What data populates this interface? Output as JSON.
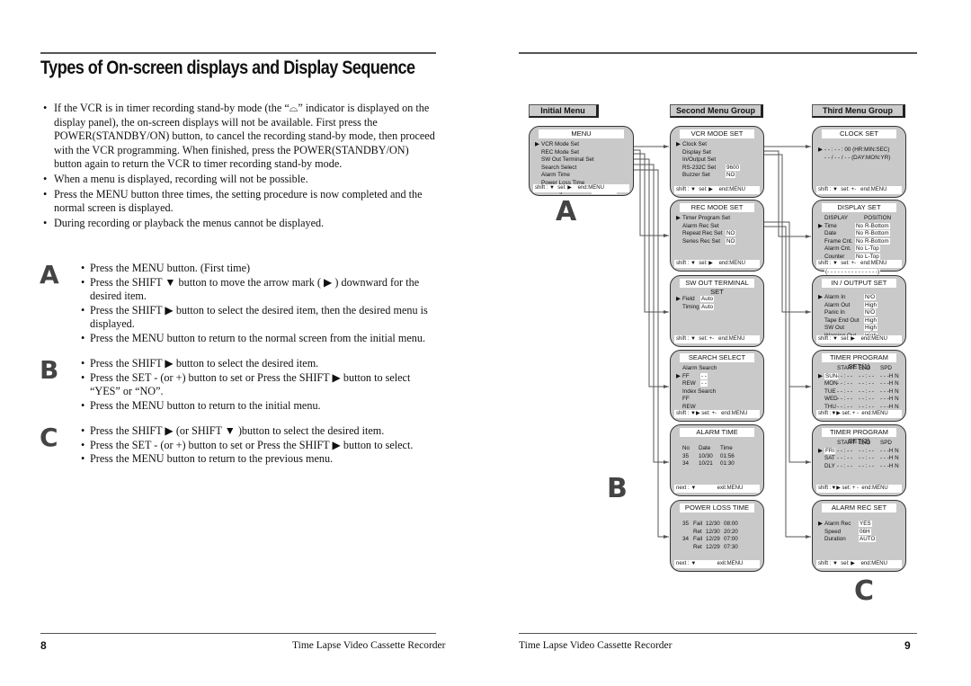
{
  "left": {
    "title": "Types of On-screen displays and Display Sequence",
    "bullets": [
      "If the VCR is in timer recording stand-by mode (the “⌓” indicator is displayed on the display panel), the on-screen displays will not be available. First press the POWER(STANDBY/ON) button, to cancel the recording stand-by mode, then proceed with the VCR programming. When finished, press the POWER(STANDBY/ON) button again to return the VCR to timer recording stand-by mode.",
      "When a menu is displayed, recording will not be possible.",
      "Press the MENU button three times, the setting procedure is now completed and the normal screen is displayed.",
      "During recording or playback the menus cannot be displayed."
    ],
    "steps": [
      {
        "letter": "A",
        "items": [
          "Press the MENU button. (First time)",
          "Press the SHIFT ▼ button to move the arrow mark ( ▶ ) downward for the desired item.",
          "Press the SHIFT ▶ button to select the desired item, then the desired menu is displayed.",
          "Press the MENU button to return to the normal screen from the initial menu."
        ]
      },
      {
        "letter": "B",
        "items": [
          "Press the SHIFT ▶ button to select the desired item.",
          "Press the SET - (or +) button to set or Press the SHIFT ▶ button to select “YES” or “NO”.",
          "Press the MENU button to return to the initial menu."
        ]
      },
      {
        "letter": "C",
        "items": [
          "Press the SHIFT ▶ (or SHIFT ▼ )button to select the desired item.",
          "Press the SET - (or +) button to set or Press the SHIFT ▶ button to select.",
          "Press the MENU button to return to the previous menu."
        ]
      }
    ],
    "page_number": "8",
    "footer": "Time Lapse Video Cassette Recorder"
  },
  "right": {
    "groups": [
      "Initial Menu",
      "Second Menu Group",
      "Third  Menu Group"
    ],
    "letters": [
      "A",
      "B",
      "C"
    ],
    "page_number": "9",
    "footer": "Time Lapse Video Cassette Recorder",
    "selector": "▶",
    "menus": [
      {
        "id": "menu",
        "title": "MENU",
        "footer": "shift : ▼  sel: ▶    end:MENU",
        "lines": [
          {
            "sel": true,
            "cells": [
              "VCR Mode Set"
            ]
          },
          {
            "cells": [
              "REC Mode Set"
            ]
          },
          {
            "cells": [
              "SW Out Terminal Set"
            ]
          },
          {
            "cells": [
              "Search Select"
            ]
          },
          {
            "cells": [
              "Alarm Time"
            ]
          },
          {
            "cells": [
              "Power Loss Time"
            ]
          },
          {
            "cells": [
              "Running Time",
              "000000H"
            ],
            "boxed": [
              1
            ]
          }
        ]
      },
      {
        "id": "vcr",
        "title": "VCR MODE SET",
        "footer": "shift : ▼  sel: ▶    end:MENU",
        "lines": [
          {
            "sel": true,
            "cells": [
              "Clock Set"
            ]
          },
          {
            "cells": [
              "Display Set"
            ]
          },
          {
            "cells": [
              "In/Output Set"
            ]
          },
          {
            "cells": [
              "RS-232C Set",
              "9600"
            ],
            "boxed": [
              1
            ]
          },
          {
            "cells": [
              "Buzzer Set",
              "NO"
            ],
            "boxed": [
              1
            ]
          }
        ]
      },
      {
        "id": "rec",
        "title": "REC MODE SET",
        "footer": "shift : ▼  sel: ▶    end:MENU",
        "lines": [
          {
            "sel": true,
            "cells": [
              "Timer Program Set"
            ]
          },
          {
            "cells": [
              "Alarm Rec Set"
            ]
          },
          {
            "cells": [
              "Repeat Rec Set",
              "NO"
            ],
            "boxed": [
              1
            ]
          },
          {
            "cells": [
              "Series Rec Set",
              "NO"
            ],
            "boxed": [
              1
            ]
          }
        ]
      },
      {
        "id": "sw",
        "title": "SW OUT TERMINAL SET",
        "footer": "shift : ▼  set: +-   end:MENU",
        "lines": [
          {
            "sel": true,
            "cells": [
              "Field",
              "Auto"
            ],
            "boxed": [
              1
            ]
          },
          {
            "cells": [
              "Timing",
              "Auto"
            ],
            "boxed": [
              1
            ]
          }
        ]
      },
      {
        "id": "search",
        "title": "SEARCH SELECT",
        "footer": "shift : ▼▶ set: +-   end:MENU",
        "lines": [
          {
            "cells": [
              "Alarm Search"
            ]
          },
          {
            "sel": true,
            "cells": [
              "FF",
              "- -"
            ],
            "boxed": [
              1
            ]
          },
          {
            "cells": [
              "REW",
              "- -"
            ],
            "boxed": [
              1
            ]
          },
          {
            "cells": [
              "Index Search"
            ]
          },
          {
            "cells": [
              "FF"
            ]
          },
          {
            "cells": [
              "REW"
            ]
          },
          {
            "cells": [
              "Zero Search"
            ]
          }
        ]
      },
      {
        "id": "alarmtime",
        "title": "ALARM TIME",
        "footer": "next : ▼              exit:MENU",
        "lines": [
          {
            "cells": [
              "No",
              "Date",
              "Time"
            ]
          },
          {
            "cells": [
              "35",
              "10/30",
              "01:56"
            ]
          },
          {
            "cells": [
              "34",
              "10/21",
              "01:30"
            ]
          }
        ]
      },
      {
        "id": "powerloss",
        "title": "POWER LOSS TIME",
        "footer": "next : ▼              exit:MENU",
        "lines": [
          {
            "cells": [
              "35",
              "Fail",
              "12/30",
              "08:00"
            ]
          },
          {
            "cells": [
              "",
              "Ret",
              "12/30",
              "20:20"
            ]
          },
          {
            "cells": [
              "34",
              "Fail",
              "12/29",
              "07:00"
            ]
          },
          {
            "cells": [
              "",
              "Ret",
              "12/29",
              "07:30"
            ]
          }
        ]
      },
      {
        "id": "clock",
        "title": "CLOCK SET",
        "footer": "shift : ▼  set: +-   end:MENU",
        "lines": [
          {
            "sel": true,
            "cells": [
              "- - : - -  : 00  (HR:MIN:SEC)"
            ]
          },
          {
            "cells": [
              "- - / - - / - -   (DAY:MON:YR)"
            ]
          }
        ]
      },
      {
        "id": "display",
        "title": "DISPLAY SET",
        "footer": "shift : ▼  set: +-   end:MENU",
        "lines": [
          {
            "cells": [
              "DISPLAY",
              "",
              "POSITION"
            ]
          },
          {
            "sel": true,
            "cells": [
              "Time",
              "No",
              "R-Bottom"
            ],
            "boxed": [
              1,
              2
            ]
          },
          {
            "cells": [
              "Date",
              "No",
              "R-Bottom"
            ],
            "boxed": [
              1,
              2
            ]
          },
          {
            "cells": [
              "Frame Cnt.",
              "No",
              "R-Bottom"
            ],
            "boxed": [
              1,
              2
            ]
          },
          {
            "cells": [
              "Alarm Cnt.",
              "No",
              "L-Top"
            ],
            "boxed": [
              1,
              2
            ]
          },
          {
            "cells": [
              "Counter",
              "No",
              "L-Top"
            ],
            "boxed": [
              1,
              2
            ]
          },
          {
            "cells": [
              "Title",
              "No",
              "L-Top"
            ],
            "boxed": [
              1,
              2
            ]
          },
          {
            "cells": [
              "(- - - - - - - - - - - - - - -)"
            ],
            "boxed": [
              0
            ]
          }
        ]
      },
      {
        "id": "inout",
        "title": "IN / OUTPUT SET",
        "footer": "shift : ▼  sel: ▶    end:MENU",
        "lines": [
          {
            "sel": true,
            "cells": [
              "Alarm In",
              "N/O"
            ],
            "boxed": [
              1
            ]
          },
          {
            "cells": [
              "Alarm Out",
              "High"
            ],
            "boxed": [
              1
            ]
          },
          {
            "cells": [
              "Panic In",
              "N/O"
            ],
            "boxed": [
              1
            ]
          },
          {
            "cells": [
              "Tape End Out",
              "High"
            ],
            "boxed": [
              1
            ]
          },
          {
            "cells": [
              "SW Out",
              "High"
            ],
            "boxed": [
              1
            ]
          },
          {
            "cells": [
              "Warning Out",
              "High"
            ],
            "boxed": [
              1
            ]
          }
        ]
      },
      {
        "id": "timer1",
        "title": "TIMER PROGRAM SET(1)",
        "footer": "shift :▼▶ set: + -  end:MENU",
        "lines": [
          {
            "cells": [
              "",
              "START",
              "END",
              "SPD"
            ]
          },
          {
            "sel": true,
            "cells": [
              "SUN",
              "- - : - -",
              "- - : - -",
              "- - -H  N"
            ],
            "boxed": [
              0
            ]
          },
          {
            "cells": [
              "MON",
              "- - : - -",
              "- - : - -",
              "- - -H  N"
            ]
          },
          {
            "cells": [
              "TUE",
              "- - : - -",
              "- - : - -",
              "- - -H  N"
            ]
          },
          {
            "cells": [
              "WED",
              "- - : - -",
              "- - : - -",
              "- - -H  N"
            ]
          },
          {
            "cells": [
              "THU",
              "- - : - -",
              "- - : - -",
              "- - -H  N"
            ]
          }
        ]
      },
      {
        "id": "timer2",
        "title": "TIMER PROGRAM SET(2)",
        "footer": "shift :▼▶ set: + -  end:MENU",
        "lines": [
          {
            "cells": [
              "",
              "START",
              "END",
              "SPD"
            ]
          },
          {
            "sel": true,
            "cells": [
              "FRI",
              "- - : - -",
              "- - : - -",
              "- - -H  N"
            ],
            "boxed": [
              0
            ]
          },
          {
            "cells": [
              "SAT",
              "- - : - -",
              "- - : - -",
              "- - -H  N"
            ]
          },
          {
            "cells": [
              "DLY",
              "- - : - -",
              "- - : - -",
              "- - -H  N"
            ]
          }
        ]
      },
      {
        "id": "alarmrec",
        "title": "ALARM REC SET",
        "footer": "shift : ▼  sel: ▶    end:MENU",
        "lines": [
          {
            "sel": true,
            "cells": [
              "Alarm Rec",
              "YES"
            ],
            "boxed": [
              1
            ]
          },
          {
            "cells": [
              "Speed",
              "06H"
            ],
            "boxed": [
              1
            ]
          },
          {
            "cells": [
              "Duration",
              "AUTO"
            ],
            "boxed": [
              1
            ]
          }
        ]
      }
    ]
  }
}
